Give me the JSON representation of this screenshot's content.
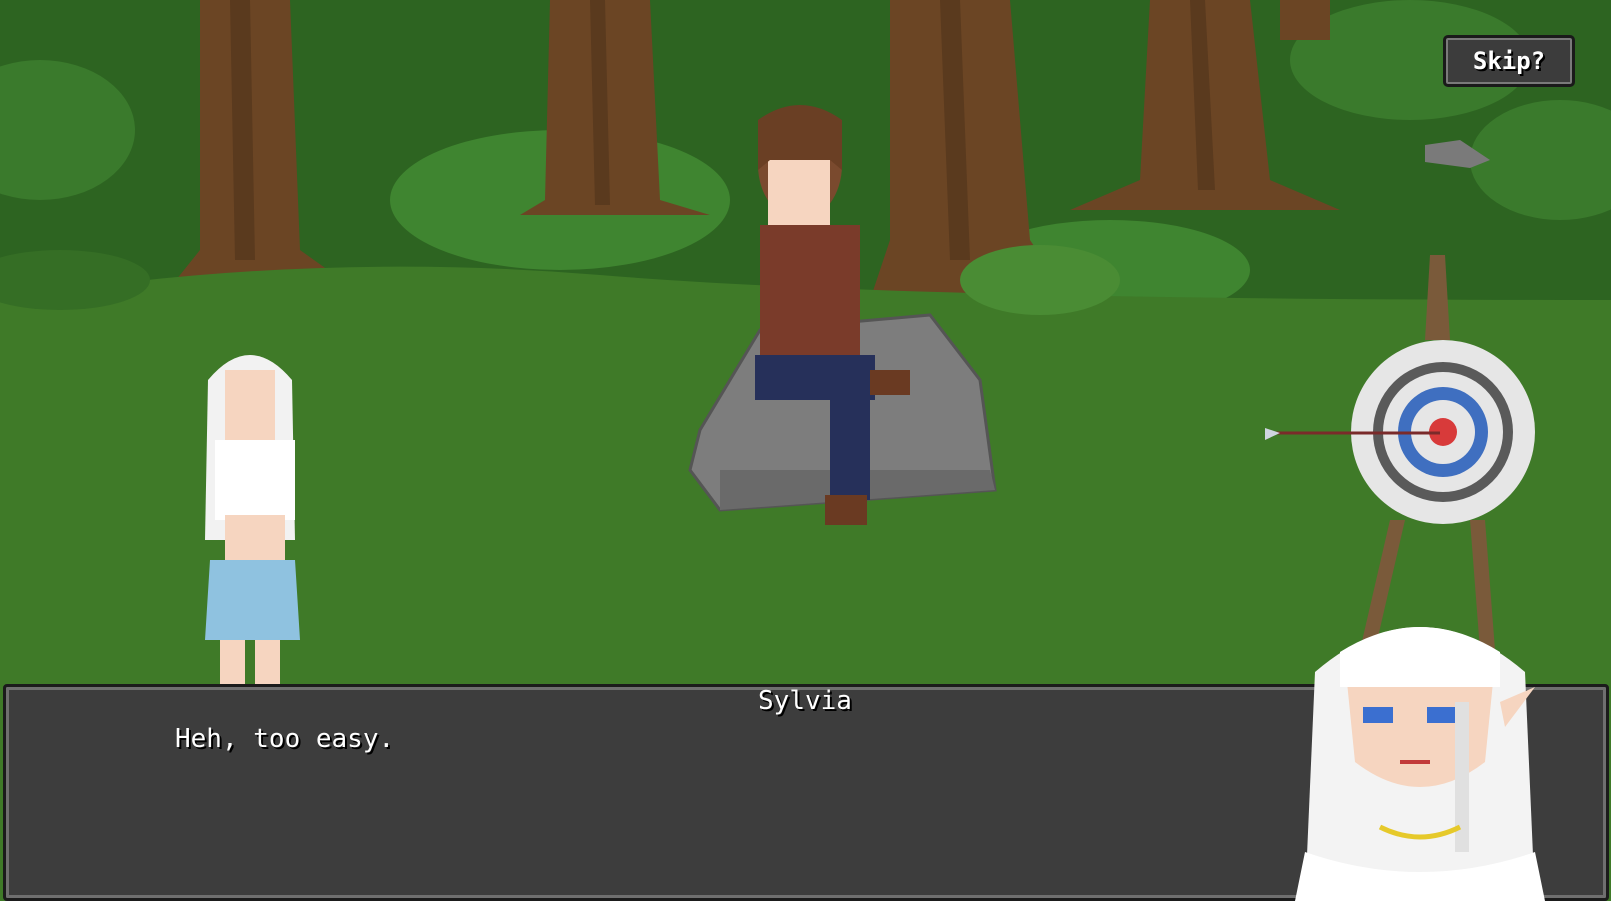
{
  "skip_button": {
    "label": "Skip?"
  },
  "dialogue": {
    "speaker": "Sylvia",
    "text": "Heh, too easy."
  },
  "colors": {
    "grass": "#3f7a28",
    "foliage": "#2e6a25",
    "bark": "#6b4524",
    "dialog_bg": "#3d3d3d",
    "dialog_border": "#1b1b1b",
    "text": "#ffffff"
  },
  "icons": [
    "archery-target-icon",
    "arrow-icon",
    "rock-icon"
  ]
}
